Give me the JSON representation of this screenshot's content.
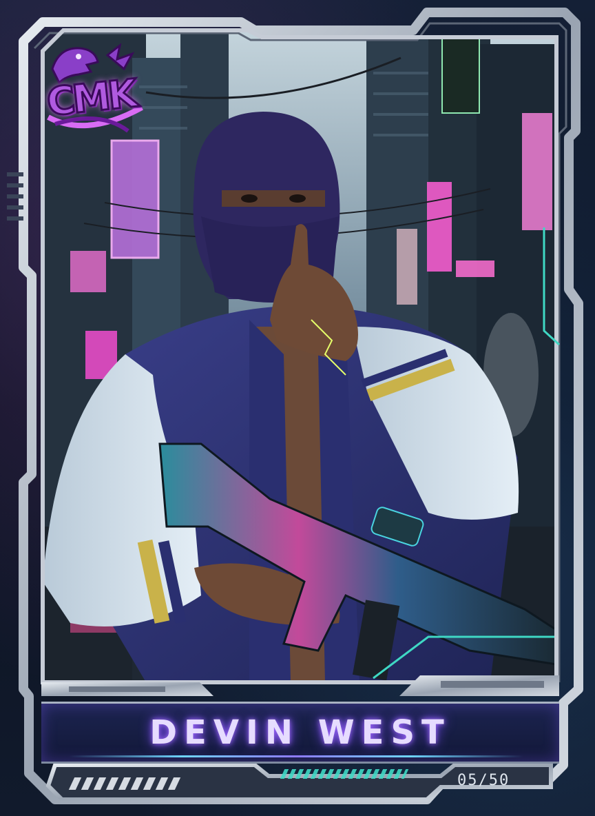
{
  "card": {
    "player_name": "DEVIN WEST",
    "serial_number": "05/50",
    "logo_text": "CMK",
    "logo_icon": "dinosaur-icon"
  },
  "colors": {
    "frame": "#b8c0cc",
    "name_glow": "#a46bff",
    "accent_teal": "#3fd8c4",
    "neon_pink": "#ff4fd8"
  }
}
